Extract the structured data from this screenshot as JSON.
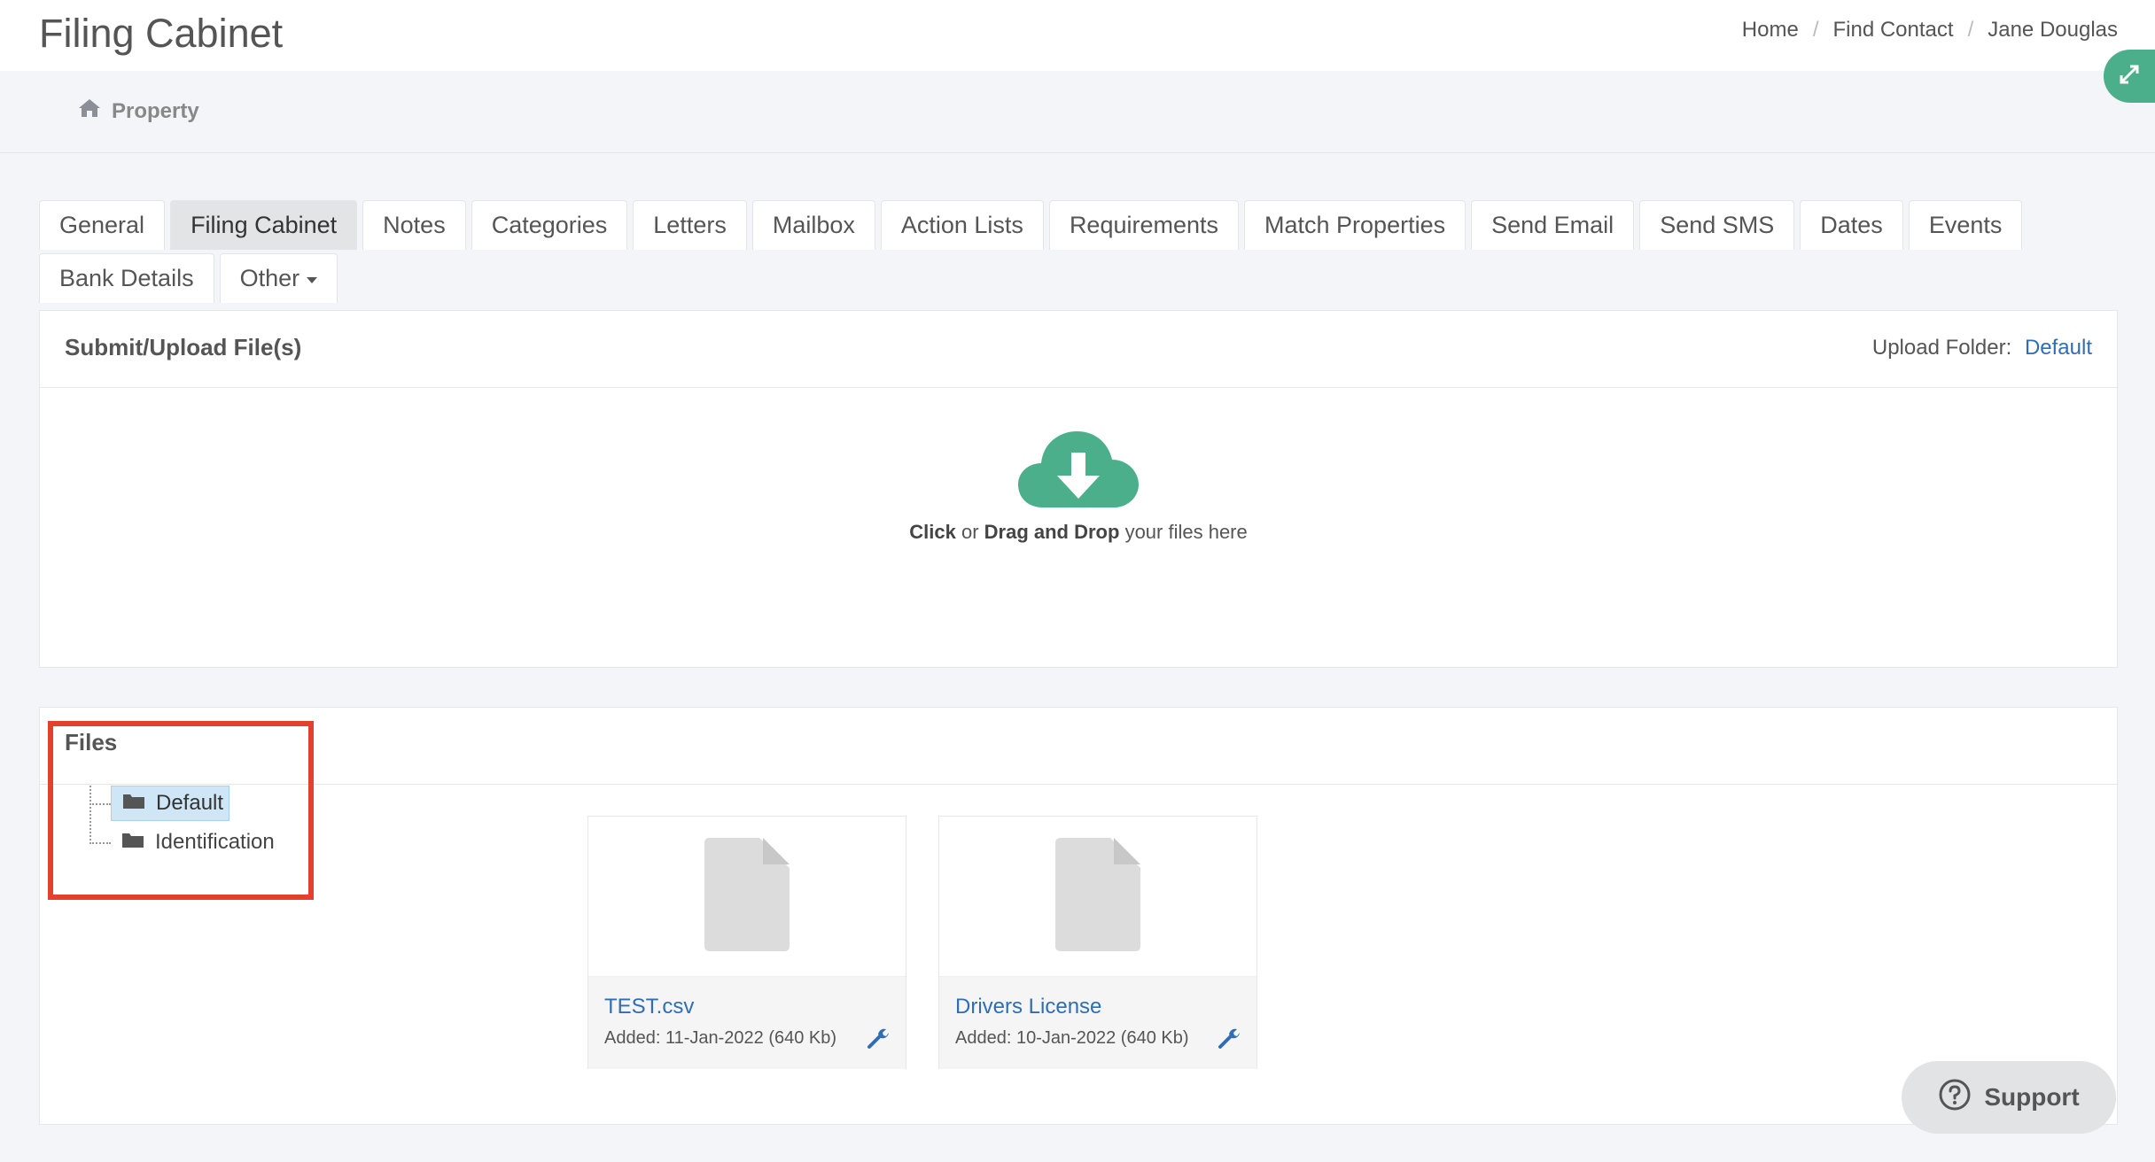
{
  "header": {
    "title": "Filing Cabinet",
    "breadcrumb": [
      "Home",
      "Find Contact",
      "Jane Douglas"
    ]
  },
  "subbar": {
    "property_label": "Property"
  },
  "tabs": {
    "row1": [
      "General",
      "Filing Cabinet",
      "Notes",
      "Categories",
      "Letters",
      "Mailbox",
      "Action Lists",
      "Requirements",
      "Match Properties",
      "Send Email",
      "Send SMS",
      "Dates",
      "Events"
    ],
    "row2": [
      "Bank Details",
      "Other"
    ],
    "active": "Filing Cabinet"
  },
  "upload": {
    "title": "Submit/Upload File(s)",
    "folder_label": "Upload Folder:",
    "folder_value": "Default",
    "drop_click": "Click",
    "drop_or": "or",
    "drop_drag": "Drag and Drop",
    "drop_rest": "your files here"
  },
  "files": {
    "title": "Files",
    "folders": [
      "Default",
      "Identification"
    ],
    "selected_folder": "Default",
    "items": [
      {
        "name": "TEST.csv",
        "added": "Added: 11-Jan-2022 (640 Kb)"
      },
      {
        "name": "Drivers License",
        "added": "Added: 10-Jan-2022 (640 Kb)"
      }
    ]
  },
  "support": {
    "label": "Support"
  },
  "colors": {
    "accent_green": "#4caf8b",
    "link_blue": "#2f6db5",
    "highlight_red": "#e4402e"
  }
}
